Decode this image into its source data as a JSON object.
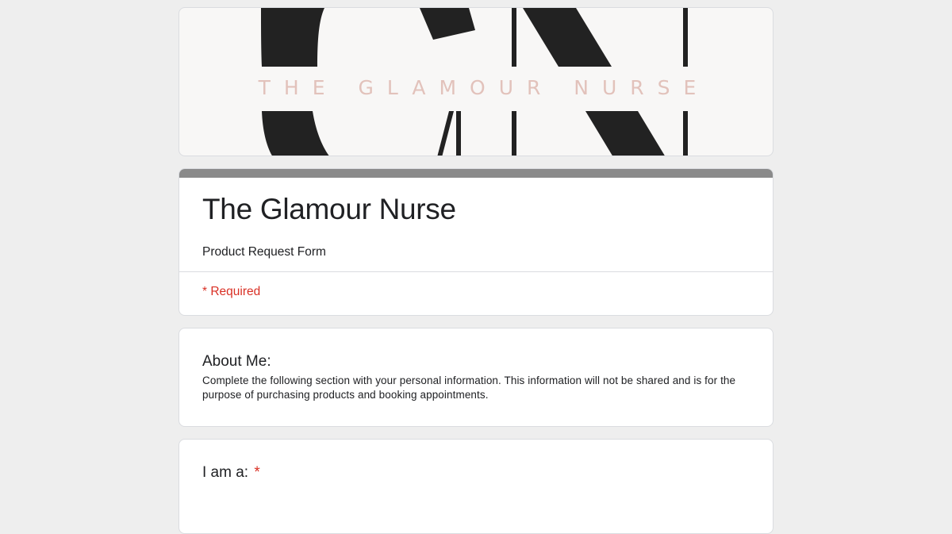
{
  "banner": {
    "brand_text": "THE GLAMOUR NURSE"
  },
  "form": {
    "title": "The Glamour Nurse",
    "description": "Product Request Form",
    "required_note": "* Required",
    "accent_color": "#8a8a8a",
    "required_color": "#d93025"
  },
  "section": {
    "title": "About Me:",
    "description": "Complete the following section with your personal information. This information will not be shared and is for the purpose of purchasing products and booking appointments."
  },
  "question": {
    "label": "I am a:",
    "required_marker": "*"
  }
}
